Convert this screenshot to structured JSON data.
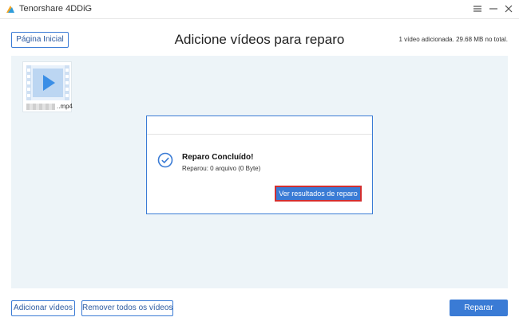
{
  "window": {
    "app_title": "Tenorshare 4DDiG",
    "menu_icon": "hamburger-icon",
    "minimize_icon": "minimize-icon",
    "close_icon": "close-icon"
  },
  "header": {
    "home_button": "Página Inicial",
    "title": "Adicione vídeos para reparo",
    "info": "1 vídeo adicionada. 29.68 MB no total."
  },
  "videos": [
    {
      "name_suffix": "..mp4",
      "icon": "video-play-icon"
    }
  ],
  "dialog": {
    "icon": "check-circle-icon",
    "heading": "Reparo Concluído!",
    "subtext": "Reparou: 0 arquivo (0 Byte)",
    "results_button": "Ver resultados de reparo"
  },
  "footer": {
    "add_button": "Adicionar vídeos",
    "remove_button": "Remover todos os vídeos",
    "repair_button": "Reparar"
  },
  "colors": {
    "accent": "#3a7bd5",
    "content_bg": "#edf4f8",
    "highlight_border": "#d32f2f",
    "success": "#3a7bd5"
  }
}
